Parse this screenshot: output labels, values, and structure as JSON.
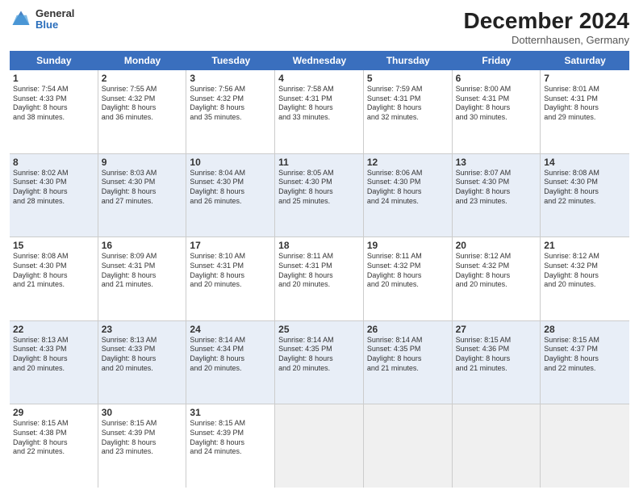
{
  "header": {
    "logo": {
      "general": "General",
      "blue": "Blue"
    },
    "month": "December 2024",
    "location": "Dotternhausen, Germany"
  },
  "weekdays": [
    "Sunday",
    "Monday",
    "Tuesday",
    "Wednesday",
    "Thursday",
    "Friday",
    "Saturday"
  ],
  "rows": [
    [
      {
        "day": "1",
        "lines": [
          "Sunrise: 7:54 AM",
          "Sunset: 4:33 PM",
          "Daylight: 8 hours",
          "and 38 minutes."
        ]
      },
      {
        "day": "2",
        "lines": [
          "Sunrise: 7:55 AM",
          "Sunset: 4:32 PM",
          "Daylight: 8 hours",
          "and 36 minutes."
        ]
      },
      {
        "day": "3",
        "lines": [
          "Sunrise: 7:56 AM",
          "Sunset: 4:32 PM",
          "Daylight: 8 hours",
          "and 35 minutes."
        ]
      },
      {
        "day": "4",
        "lines": [
          "Sunrise: 7:58 AM",
          "Sunset: 4:31 PM",
          "Daylight: 8 hours",
          "and 33 minutes."
        ]
      },
      {
        "day": "5",
        "lines": [
          "Sunrise: 7:59 AM",
          "Sunset: 4:31 PM",
          "Daylight: 8 hours",
          "and 32 minutes."
        ]
      },
      {
        "day": "6",
        "lines": [
          "Sunrise: 8:00 AM",
          "Sunset: 4:31 PM",
          "Daylight: 8 hours",
          "and 30 minutes."
        ]
      },
      {
        "day": "7",
        "lines": [
          "Sunrise: 8:01 AM",
          "Sunset: 4:31 PM",
          "Daylight: 8 hours",
          "and 29 minutes."
        ]
      }
    ],
    [
      {
        "day": "8",
        "lines": [
          "Sunrise: 8:02 AM",
          "Sunset: 4:30 PM",
          "Daylight: 8 hours",
          "and 28 minutes."
        ]
      },
      {
        "day": "9",
        "lines": [
          "Sunrise: 8:03 AM",
          "Sunset: 4:30 PM",
          "Daylight: 8 hours",
          "and 27 minutes."
        ]
      },
      {
        "day": "10",
        "lines": [
          "Sunrise: 8:04 AM",
          "Sunset: 4:30 PM",
          "Daylight: 8 hours",
          "and 26 minutes."
        ]
      },
      {
        "day": "11",
        "lines": [
          "Sunrise: 8:05 AM",
          "Sunset: 4:30 PM",
          "Daylight: 8 hours",
          "and 25 minutes."
        ]
      },
      {
        "day": "12",
        "lines": [
          "Sunrise: 8:06 AM",
          "Sunset: 4:30 PM",
          "Daylight: 8 hours",
          "and 24 minutes."
        ]
      },
      {
        "day": "13",
        "lines": [
          "Sunrise: 8:07 AM",
          "Sunset: 4:30 PM",
          "Daylight: 8 hours",
          "and 23 minutes."
        ]
      },
      {
        "day": "14",
        "lines": [
          "Sunrise: 8:08 AM",
          "Sunset: 4:30 PM",
          "Daylight: 8 hours",
          "and 22 minutes."
        ]
      }
    ],
    [
      {
        "day": "15",
        "lines": [
          "Sunrise: 8:08 AM",
          "Sunset: 4:30 PM",
          "Daylight: 8 hours",
          "and 21 minutes."
        ]
      },
      {
        "day": "16",
        "lines": [
          "Sunrise: 8:09 AM",
          "Sunset: 4:31 PM",
          "Daylight: 8 hours",
          "and 21 minutes."
        ]
      },
      {
        "day": "17",
        "lines": [
          "Sunrise: 8:10 AM",
          "Sunset: 4:31 PM",
          "Daylight: 8 hours",
          "and 20 minutes."
        ]
      },
      {
        "day": "18",
        "lines": [
          "Sunrise: 8:11 AM",
          "Sunset: 4:31 PM",
          "Daylight: 8 hours",
          "and 20 minutes."
        ]
      },
      {
        "day": "19",
        "lines": [
          "Sunrise: 8:11 AM",
          "Sunset: 4:32 PM",
          "Daylight: 8 hours",
          "and 20 minutes."
        ]
      },
      {
        "day": "20",
        "lines": [
          "Sunrise: 8:12 AM",
          "Sunset: 4:32 PM",
          "Daylight: 8 hours",
          "and 20 minutes."
        ]
      },
      {
        "day": "21",
        "lines": [
          "Sunrise: 8:12 AM",
          "Sunset: 4:32 PM",
          "Daylight: 8 hours",
          "and 20 minutes."
        ]
      }
    ],
    [
      {
        "day": "22",
        "lines": [
          "Sunrise: 8:13 AM",
          "Sunset: 4:33 PM",
          "Daylight: 8 hours",
          "and 20 minutes."
        ]
      },
      {
        "day": "23",
        "lines": [
          "Sunrise: 8:13 AM",
          "Sunset: 4:33 PM",
          "Daylight: 8 hours",
          "and 20 minutes."
        ]
      },
      {
        "day": "24",
        "lines": [
          "Sunrise: 8:14 AM",
          "Sunset: 4:34 PM",
          "Daylight: 8 hours",
          "and 20 minutes."
        ]
      },
      {
        "day": "25",
        "lines": [
          "Sunrise: 8:14 AM",
          "Sunset: 4:35 PM",
          "Daylight: 8 hours",
          "and 20 minutes."
        ]
      },
      {
        "day": "26",
        "lines": [
          "Sunrise: 8:14 AM",
          "Sunset: 4:35 PM",
          "Daylight: 8 hours",
          "and 21 minutes."
        ]
      },
      {
        "day": "27",
        "lines": [
          "Sunrise: 8:15 AM",
          "Sunset: 4:36 PM",
          "Daylight: 8 hours",
          "and 21 minutes."
        ]
      },
      {
        "day": "28",
        "lines": [
          "Sunrise: 8:15 AM",
          "Sunset: 4:37 PM",
          "Daylight: 8 hours",
          "and 22 minutes."
        ]
      }
    ],
    [
      {
        "day": "29",
        "lines": [
          "Sunrise: 8:15 AM",
          "Sunset: 4:38 PM",
          "Daylight: 8 hours",
          "and 22 minutes."
        ]
      },
      {
        "day": "30",
        "lines": [
          "Sunrise: 8:15 AM",
          "Sunset: 4:39 PM",
          "Daylight: 8 hours",
          "and 23 minutes."
        ]
      },
      {
        "day": "31",
        "lines": [
          "Sunrise: 8:15 AM",
          "Sunset: 4:39 PM",
          "Daylight: 8 hours",
          "and 24 minutes."
        ]
      },
      {
        "day": "",
        "lines": []
      },
      {
        "day": "",
        "lines": []
      },
      {
        "day": "",
        "lines": []
      },
      {
        "day": "",
        "lines": []
      }
    ]
  ]
}
